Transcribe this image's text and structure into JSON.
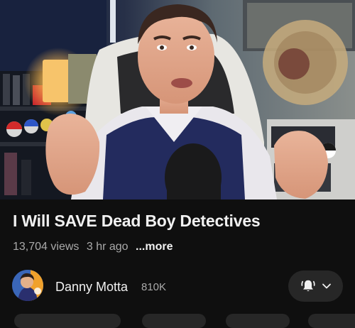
{
  "video": {
    "title": "I Will SAVE Dead Boy Detectives",
    "views": "13,704 views",
    "age": "3 hr ago",
    "more_label": "...more"
  },
  "channel": {
    "name": "Danny Motta",
    "subscribers": "810K"
  },
  "subscribe_menu": {
    "bell_icon": "bell-ring-icon",
    "chevron_icon": "chevron-down-icon"
  },
  "colors": {
    "background": "#0f0f0f",
    "text_primary": "#f1f1f1",
    "text_secondary": "#aaaaaa",
    "pill": "#272727"
  }
}
